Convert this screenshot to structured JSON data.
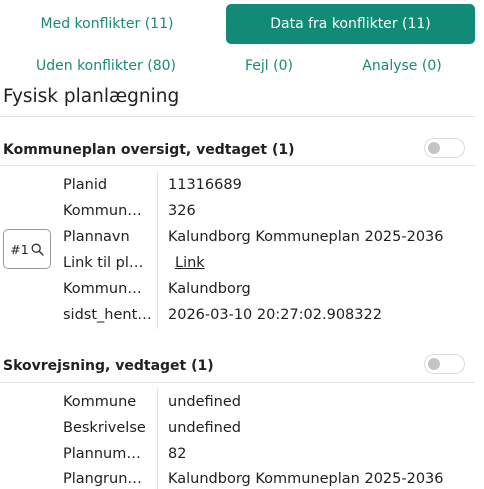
{
  "tabs": [
    {
      "label": "Med konflikter (11)",
      "active": false
    },
    {
      "label": "Data fra konflikter (11)",
      "active": true
    },
    {
      "label": "Uden konflikter (80)",
      "active": false
    },
    {
      "label": "Fejl (0)",
      "active": false
    },
    {
      "label": "Analyse (0)",
      "active": false
    }
  ],
  "page_title": "Fysisk planlægning",
  "sections": [
    {
      "heading": "Kommuneplan oversigt, vedtaget (1)",
      "record_button_label": "#1",
      "rows": [
        {
          "label": "Planid",
          "value": "11316689"
        },
        {
          "label": "Kommun…",
          "value": "326"
        },
        {
          "label": "Plannavn",
          "value": "Kalundborg Kommuneplan 2025-2036"
        },
        {
          "label": "Link til pl…",
          "value": "Link"
        },
        {
          "label": "Kommun…",
          "value": "Kalundborg"
        },
        {
          "label": "sidst_hent…",
          "value": "2026-03-10 20:27:02.908322"
        }
      ]
    },
    {
      "heading": "Skovrejsning, vedtaget (1)",
      "rows": [
        {
          "label": "Kommune",
          "value": "undefined"
        },
        {
          "label": "Beskrivelse",
          "value": "undefined"
        },
        {
          "label": "Plannum…",
          "value": "82"
        },
        {
          "label": "Plangrun…",
          "value": "Kalundborg Kommuneplan 2025-2036"
        }
      ]
    }
  ],
  "colors": {
    "accent": "#118b76",
    "accent_text": "#1a8a74",
    "divider": "#e4e4e4"
  },
  "icons": {
    "record_button": "magnifier-icon",
    "toggle": "toggle-switch"
  }
}
